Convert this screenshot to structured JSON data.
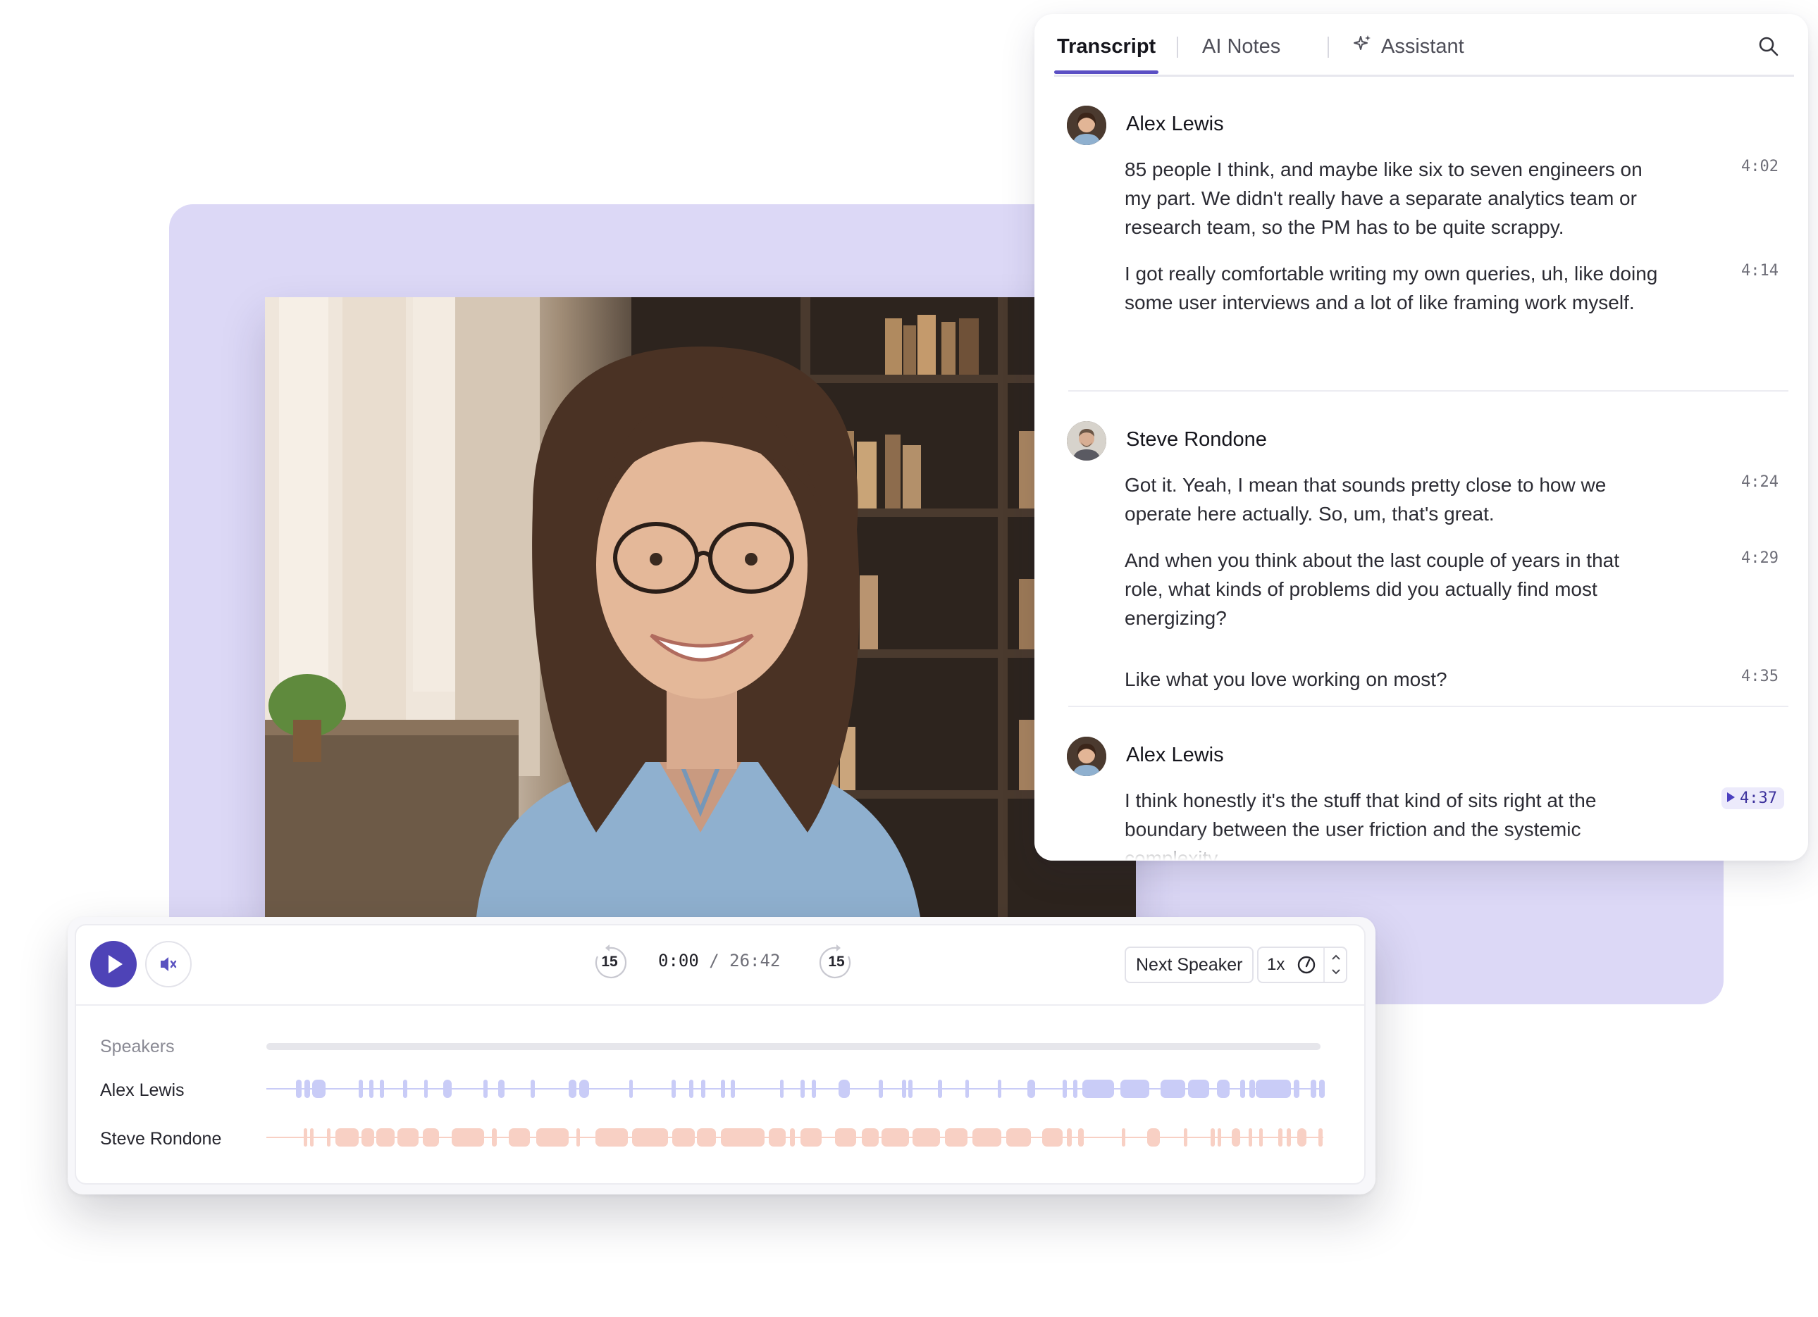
{
  "colors": {
    "accent": "#4e43b7",
    "alex_track": "#c9ccf7",
    "steve_track": "#f8d0c4",
    "background_card": "#dcd8f6"
  },
  "panel": {
    "tabs": [
      {
        "label": "Transcript",
        "active": true
      },
      {
        "label": "AI Notes",
        "active": false
      },
      {
        "label": "Assistant",
        "active": false,
        "icon": "sparkle-icon"
      }
    ],
    "search_icon": "search-icon",
    "groups": [
      {
        "speaker": "Alex Lewis",
        "utterances": [
          {
            "text": "85 people I think, and maybe like six to seven engineers on my part. We didn't really have a separate analytics team or research team, so the PM has to be quite scrappy.",
            "time": "4:02"
          },
          {
            "text": "I got really comfortable writing my own queries, uh, like doing some user interviews and a lot of like framing work myself.",
            "time": "4:14"
          }
        ]
      },
      {
        "speaker": "Steve Rondone",
        "utterances": [
          {
            "text": "Got it. Yeah, I mean that sounds pretty close to how we operate here actually. So, um, that's great.",
            "time": "4:24"
          },
          {
            "text": "And when you think about the last couple of years in that role, what kinds of problems did you actually find most energizing?",
            "time": "4:29"
          },
          {
            "text": "Like what you love working on most?",
            "time": "4:35"
          }
        ]
      },
      {
        "speaker": "Alex Lewis",
        "utterances": [
          {
            "text": "I think honestly it's the stuff that kind of sits right at the boundary between the user friction and the systemic complexity.",
            "time": "4:37",
            "playing": true
          }
        ]
      }
    ]
  },
  "player": {
    "current_time": "0:00",
    "separator": "/",
    "total_time": "26:42",
    "skip_back": "15",
    "skip_forward": "15",
    "next_speaker_label": "Next Speaker",
    "speed": "1x",
    "progress": 0.0,
    "speakers_title": "Speakers",
    "tracks": [
      {
        "name": "Alex Lewis",
        "color": "#c9ccf7",
        "segments": [
          [
            0.028,
            0.005
          ],
          [
            0.036,
            0.005
          ],
          [
            0.043,
            0.013
          ],
          [
            0.087,
            0.004
          ],
          [
            0.097,
            0.004
          ],
          [
            0.107,
            0.004
          ],
          [
            0.129,
            0.004
          ],
          [
            0.149,
            0.003
          ],
          [
            0.167,
            0.008
          ],
          [
            0.205,
            0.004
          ],
          [
            0.219,
            0.006
          ],
          [
            0.25,
            0.004
          ],
          [
            0.286,
            0.007
          ],
          [
            0.296,
            0.009
          ],
          [
            0.343,
            0.003
          ],
          [
            0.383,
            0.004
          ],
          [
            0.4,
            0.004
          ],
          [
            0.411,
            0.004
          ],
          [
            0.43,
            0.004
          ],
          [
            0.439,
            0.004
          ],
          [
            0.486,
            0.003
          ],
          [
            0.505,
            0.004
          ],
          [
            0.516,
            0.004
          ],
          [
            0.541,
            0.011
          ],
          [
            0.579,
            0.004
          ],
          [
            0.601,
            0.004
          ],
          [
            0.607,
            0.004
          ],
          [
            0.635,
            0.004
          ],
          [
            0.661,
            0.003
          ],
          [
            0.692,
            0.003
          ],
          [
            0.72,
            0.007
          ],
          [
            0.753,
            0.004
          ],
          [
            0.763,
            0.004
          ],
          [
            0.772,
            0.03
          ],
          [
            0.808,
            0.027
          ],
          [
            0.846,
            0.023
          ],
          [
            0.872,
            0.02
          ],
          [
            0.899,
            0.012
          ],
          [
            0.921,
            0.005
          ],
          [
            0.93,
            0.005
          ],
          [
            0.936,
            0.033
          ],
          [
            0.972,
            0.005
          ],
          [
            0.988,
            0.005
          ],
          [
            0.996,
            0.005
          ]
        ]
      },
      {
        "name": "Steve Rondone",
        "color": "#f8d0c4",
        "segments": [
          [
            0.035,
            0.003
          ],
          [
            0.041,
            0.003
          ],
          [
            0.057,
            0.003
          ],
          [
            0.065,
            0.022
          ],
          [
            0.09,
            0.012
          ],
          [
            0.104,
            0.017
          ],
          [
            0.124,
            0.02
          ],
          [
            0.148,
            0.015
          ],
          [
            0.175,
            0.031
          ],
          [
            0.213,
            0.005
          ],
          [
            0.229,
            0.02
          ],
          [
            0.255,
            0.031
          ],
          [
            0.293,
            0.003
          ],
          [
            0.311,
            0.031
          ],
          [
            0.346,
            0.034
          ],
          [
            0.384,
            0.021
          ],
          [
            0.407,
            0.018
          ],
          [
            0.43,
            0.041
          ],
          [
            0.475,
            0.016
          ],
          [
            0.495,
            0.005
          ],
          [
            0.505,
            0.02
          ],
          [
            0.538,
            0.02
          ],
          [
            0.563,
            0.016
          ],
          [
            0.582,
            0.026
          ],
          [
            0.611,
            0.026
          ],
          [
            0.642,
            0.021
          ],
          [
            0.668,
            0.027
          ],
          [
            0.7,
            0.023
          ],
          [
            0.734,
            0.019
          ],
          [
            0.757,
            0.005
          ],
          [
            0.768,
            0.005
          ],
          [
            0.809,
            0.003
          ],
          [
            0.833,
            0.012
          ],
          [
            0.868,
            0.003
          ],
          [
            0.893,
            0.004
          ],
          [
            0.9,
            0.003
          ],
          [
            0.913,
            0.008
          ],
          [
            0.929,
            0.003
          ],
          [
            0.939,
            0.003
          ],
          [
            0.957,
            0.004
          ],
          [
            0.965,
            0.004
          ],
          [
            0.975,
            0.009
          ],
          [
            0.995,
            0.004
          ]
        ]
      }
    ]
  }
}
